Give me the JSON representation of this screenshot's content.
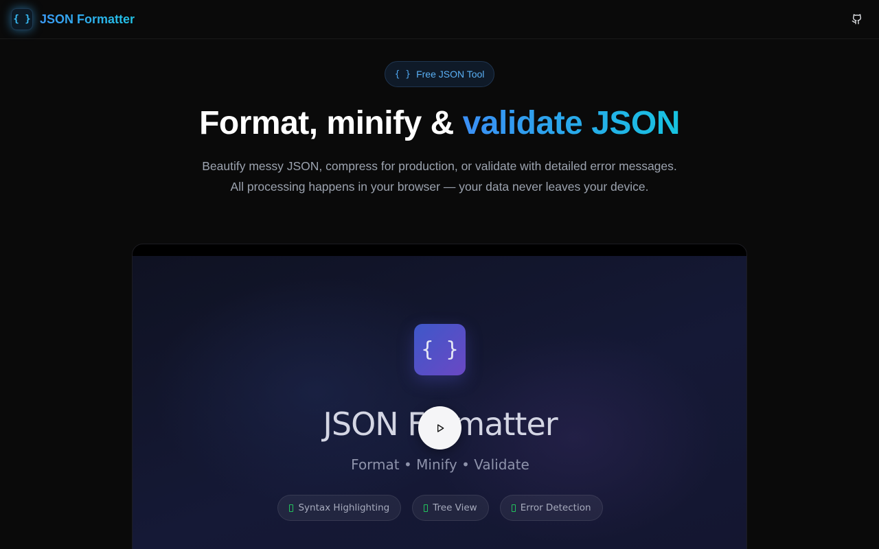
{
  "header": {
    "brand_icon": "{ }",
    "brand_name": "JSON Formatter",
    "github_icon": "github-icon"
  },
  "hero": {
    "badge_icon": "{ }",
    "badge_label": "Free JSON Tool",
    "headline_plain": "Format, minify & ",
    "headline_accent": "validate JSON",
    "subtitle": "Beautify messy JSON, compress for production, or validate with detailed error messages. All processing happens in your browser — your data never leaves your device."
  },
  "video": {
    "icon": "{ }",
    "title": "JSON Formatter",
    "tagline": "Format • Minify • Validate",
    "play_icon": "play-icon",
    "chips": [
      {
        "label": "Syntax Highlighting"
      },
      {
        "label": "Tree View"
      },
      {
        "label": "Error Detection"
      }
    ]
  },
  "colors": {
    "background": "#0a0a0a",
    "accent_blue": "#3b8ff5",
    "accent_cyan": "#17c3e0",
    "chip_check": "#22c55e"
  }
}
